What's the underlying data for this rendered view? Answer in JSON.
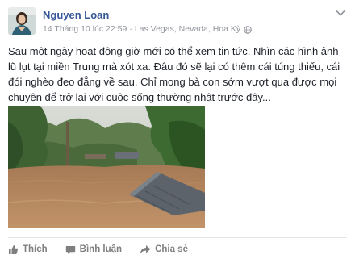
{
  "post": {
    "author": "Nguyen Loan",
    "timestamp": "14 Tháng 10 lúc 22:59",
    "separator": "·",
    "location": "Las Vegas, Nevada, Hoa Kỳ",
    "privacy_icon": "globe-icon",
    "text": "Sau một ngày hoạt động giờ mới có thể xem tin tức. Nhìn các hình ảnh lũ lụt tại miền Trung mà xót xa. Đâu đó sẽ lại có thêm cái túng thiếu, cái đói nghèo đeo đẳng về sau. Chỉ mong bà con sớm vượt qua được mọi chuyện để trở lại với cuộc sống thường nhật trước đây..."
  },
  "actions": {
    "like_label": "Thích",
    "comment_label": "Bình luận",
    "share_label": "Chia sẻ"
  },
  "colors": {
    "author_link": "#365899",
    "meta_text": "#90949c",
    "action_text": "#7f7f7f",
    "flood_water": "#b0835a"
  }
}
